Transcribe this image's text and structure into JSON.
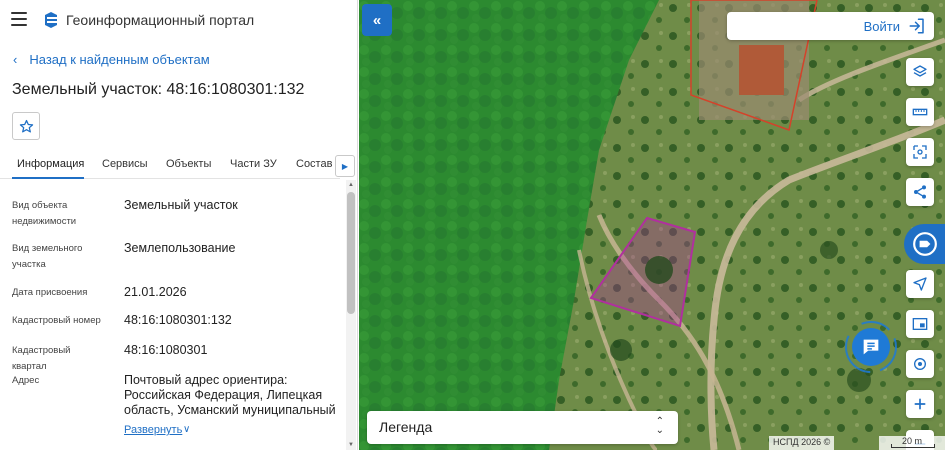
{
  "header": {
    "menu_icon": "hamburger-icon",
    "logo_icon": "portal-logo-icon",
    "title": "Геоинформационный портал"
  },
  "nav": {
    "back_label": "Назад к найденным объектам"
  },
  "object": {
    "title": "Земельный участок: 48:16:1080301:132"
  },
  "tabs": [
    {
      "label": "Информация",
      "active": true
    },
    {
      "label": "Сервисы"
    },
    {
      "label": "Объекты"
    },
    {
      "label": "Части ЗУ"
    },
    {
      "label": "Состав"
    }
  ],
  "info": [
    {
      "label": "Вид объекта недвижимости",
      "value": "Земельный участок"
    },
    {
      "label": "Вид земельного участка",
      "value": "Землепользование"
    },
    {
      "label": "Дата присвоения",
      "value": "21.01.2026"
    },
    {
      "label": "Кадастровый номер",
      "value": "48:16:1080301:132"
    },
    {
      "label": "Кадастровый квартал",
      "value": "48:16:1080301"
    },
    {
      "label": "Адрес",
      "value": "Почтовый адрес ориентира: Российская Федерация, Липецкая область, Усманский муниципальный"
    }
  ],
  "expand_label": "Развернуть",
  "map": {
    "login_label": "Войти",
    "legend_label": "Легенда",
    "attribution": "НСПД 2026 ©",
    "scale": "20 m",
    "accent_color": "#1f6fc5",
    "parcel_color": "#b0309e",
    "tools": [
      "layers-icon",
      "ruler-icon",
      "select-area-icon",
      "share-icon",
      "map-widget-icon",
      "navigate-icon",
      "picture-in-picture-icon",
      "locate-icon",
      "zoom-in-icon"
    ]
  }
}
